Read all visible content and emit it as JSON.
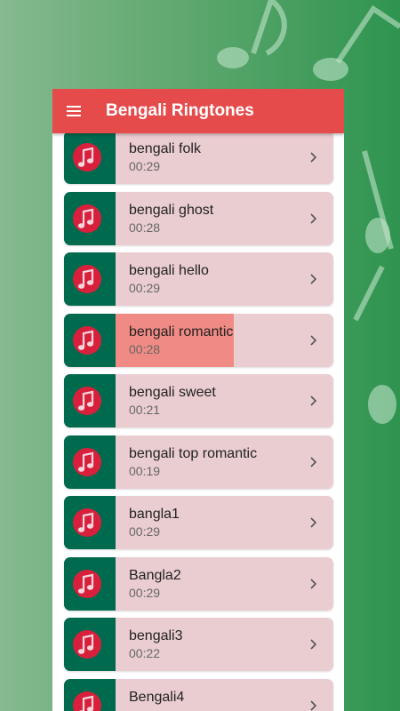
{
  "app": {
    "title": "Bengali Ringtones"
  },
  "icons": {
    "menu": "menu-icon",
    "thumb": "bangladesh-flag-music-icon",
    "chevron": "chevron-right-icon"
  },
  "colors": {
    "appbar": "#e64b4b",
    "item_bg": "#eacdd1",
    "selected_highlight": "#f08a84",
    "flag_green": "#006a4e",
    "flag_red": "#d8203c"
  },
  "ringtones": [
    {
      "name": "bengali folk",
      "duration": "00:29",
      "selected": false
    },
    {
      "name": "bengali ghost",
      "duration": "00:28",
      "selected": false
    },
    {
      "name": "bengali hello",
      "duration": "00:29",
      "selected": false
    },
    {
      "name": "bengali romantic",
      "duration": "00:28",
      "selected": true
    },
    {
      "name": "bengali sweet",
      "duration": "00:21",
      "selected": false
    },
    {
      "name": "bengali top romantic",
      "duration": "00:19",
      "selected": false
    },
    {
      "name": "bangla1",
      "duration": "00:29",
      "selected": false
    },
    {
      "name": "Bangla2",
      "duration": "00:29",
      "selected": false
    },
    {
      "name": "bengali3",
      "duration": "00:22",
      "selected": false
    },
    {
      "name": "Bengali4",
      "duration": "",
      "selected": false
    }
  ]
}
